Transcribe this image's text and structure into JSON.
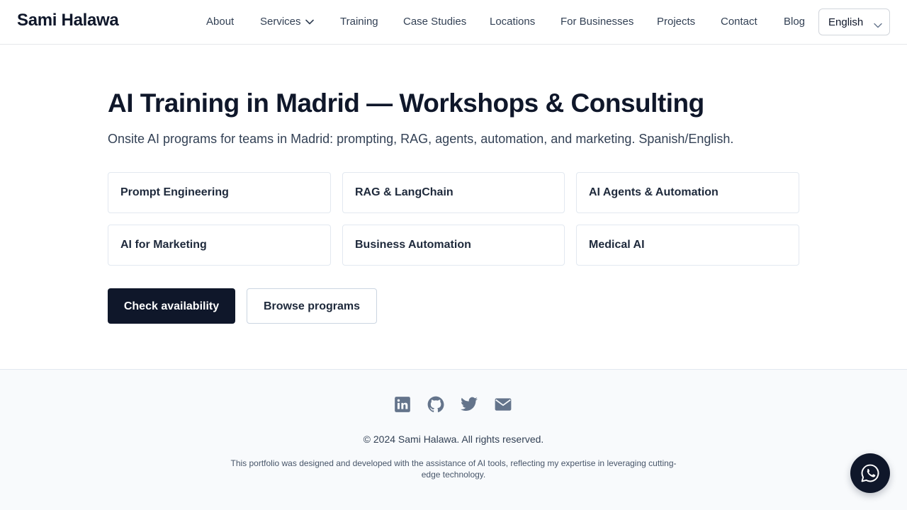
{
  "header": {
    "brand": "Sami Halawa",
    "nav": {
      "about": "About",
      "services": "Services",
      "training": "Training",
      "case_studies": "Case Studies",
      "locations": "Locations",
      "for_businesses": "For Businesses",
      "projects": "Projects",
      "contact": "Contact",
      "blog": "Blog"
    },
    "language": {
      "selected": "English"
    }
  },
  "hero": {
    "title": "AI Training in Madrid — Workshops & Consulting",
    "subtitle": "Onsite AI programs for teams in Madrid: prompting, RAG, agents, automation, and marketing. Spanish/English."
  },
  "topics": [
    "Prompt Engineering",
    "RAG & LangChain",
    "AI Agents & Automation",
    "AI for Marketing",
    "Business Automation",
    "Medical AI"
  ],
  "actions": {
    "primary": "Check availability",
    "secondary": "Browse programs"
  },
  "footer": {
    "social_icons": [
      "linkedin-icon",
      "github-icon",
      "twitter-icon",
      "email-icon"
    ],
    "copyright": "© 2024 Sami Halawa. All rights reserved.",
    "disclaimer": "This portfolio was designed and developed with the assistance of AI tools, reflecting my expertise in leveraging cutting-edge technology."
  },
  "floating": {
    "icon": "whatsapp-icon"
  },
  "colors": {
    "primary": "#0f172a",
    "text": "#334155",
    "border": "#e2e8f0",
    "footer_bg": "#f8fafc",
    "social_icon": "#64748b"
  }
}
